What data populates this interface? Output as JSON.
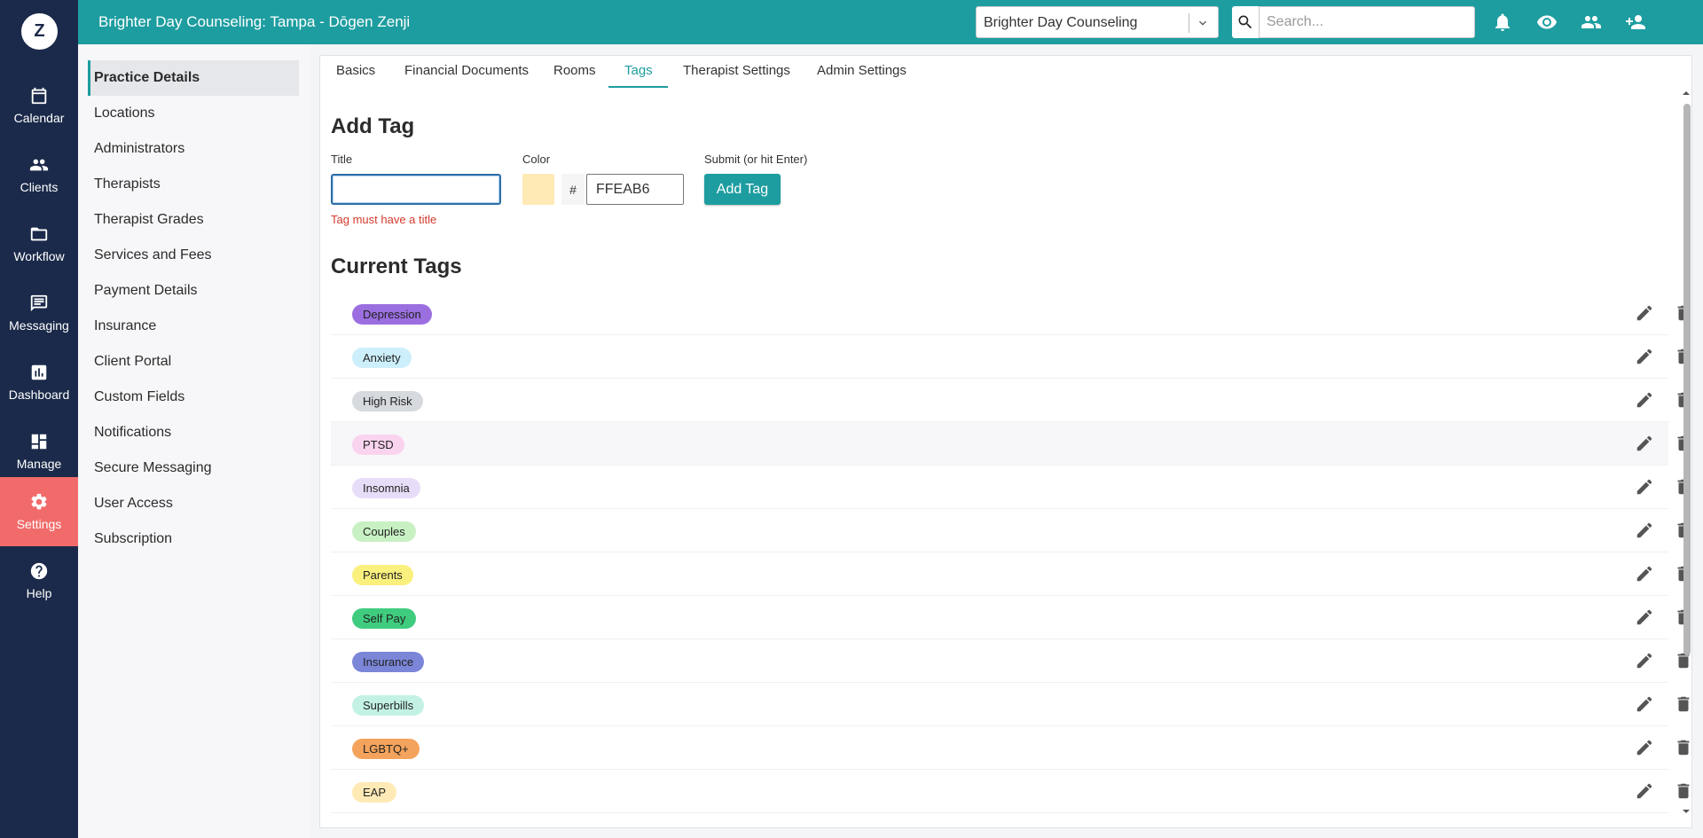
{
  "rail": {
    "logo": "Z",
    "items": [
      {
        "label": "Calendar"
      },
      {
        "label": "Clients"
      },
      {
        "label": "Workflow"
      },
      {
        "label": "Messaging"
      },
      {
        "label": "Dashboard"
      },
      {
        "label": "Manage"
      },
      {
        "label": "Settings"
      },
      {
        "label": "Help"
      }
    ],
    "active": "Settings"
  },
  "header": {
    "title": "Brighter Day Counseling: Tampa - Dōgen Zenji",
    "practice_select": "Brighter Day Counseling",
    "search_placeholder": "Search...",
    "icons": [
      "bell-icon",
      "eye-icon",
      "people-icon",
      "person-add-icon",
      "more-vert-icon"
    ]
  },
  "subnav": {
    "items": [
      {
        "label": "Practice Details"
      },
      {
        "label": "Locations"
      },
      {
        "label": "Administrators"
      },
      {
        "label": "Therapists"
      },
      {
        "label": "Therapist Grades"
      },
      {
        "label": "Services and Fees"
      },
      {
        "label": "Payment Details"
      },
      {
        "label": "Insurance"
      },
      {
        "label": "Client Portal"
      },
      {
        "label": "Custom Fields"
      },
      {
        "label": "Notifications"
      },
      {
        "label": "Secure Messaging"
      },
      {
        "label": "User Access"
      },
      {
        "label": "Subscription"
      }
    ],
    "active": "Practice Details"
  },
  "tabs": {
    "items": [
      {
        "label": "Basics"
      },
      {
        "label": "Financial Documents"
      },
      {
        "label": "Rooms"
      },
      {
        "label": "Tags"
      },
      {
        "label": "Therapist Settings"
      },
      {
        "label": "Admin Settings"
      }
    ],
    "active": "Tags"
  },
  "add_tag": {
    "heading": "Add Tag",
    "title_label": "Title",
    "title_value": "",
    "title_error": "Tag must have a title",
    "color_label": "Color",
    "color_hash": "#",
    "color_value": "FFEAB6",
    "swatch_color": "#FFEAB6",
    "submit_label": "Submit (or hit Enter)",
    "submit_button": "Add Tag"
  },
  "current_tags": {
    "heading": "Current Tags",
    "tags": [
      {
        "name": "Depression",
        "color": "#9B6FE0"
      },
      {
        "name": "Anxiety",
        "color": "#CDEFFB"
      },
      {
        "name": "High Risk",
        "color": "#D6D9DE"
      },
      {
        "name": "PTSD",
        "color": "#FAD4EE"
      },
      {
        "name": "Insomnia",
        "color": "#E8DDF8"
      },
      {
        "name": "Couples",
        "color": "#C8F1C3"
      },
      {
        "name": "Parents",
        "color": "#FAF07E"
      },
      {
        "name": "Self Pay",
        "color": "#3FCC7E"
      },
      {
        "name": "Insurance",
        "color": "#7B86D8"
      },
      {
        "name": "Superbills",
        "color": "#C3F2E5"
      },
      {
        "name": "LGBTQ+",
        "color": "#F4A35C"
      },
      {
        "name": "EAP",
        "color": "#FFEAB6"
      }
    ],
    "highlighted": "PTSD"
  }
}
